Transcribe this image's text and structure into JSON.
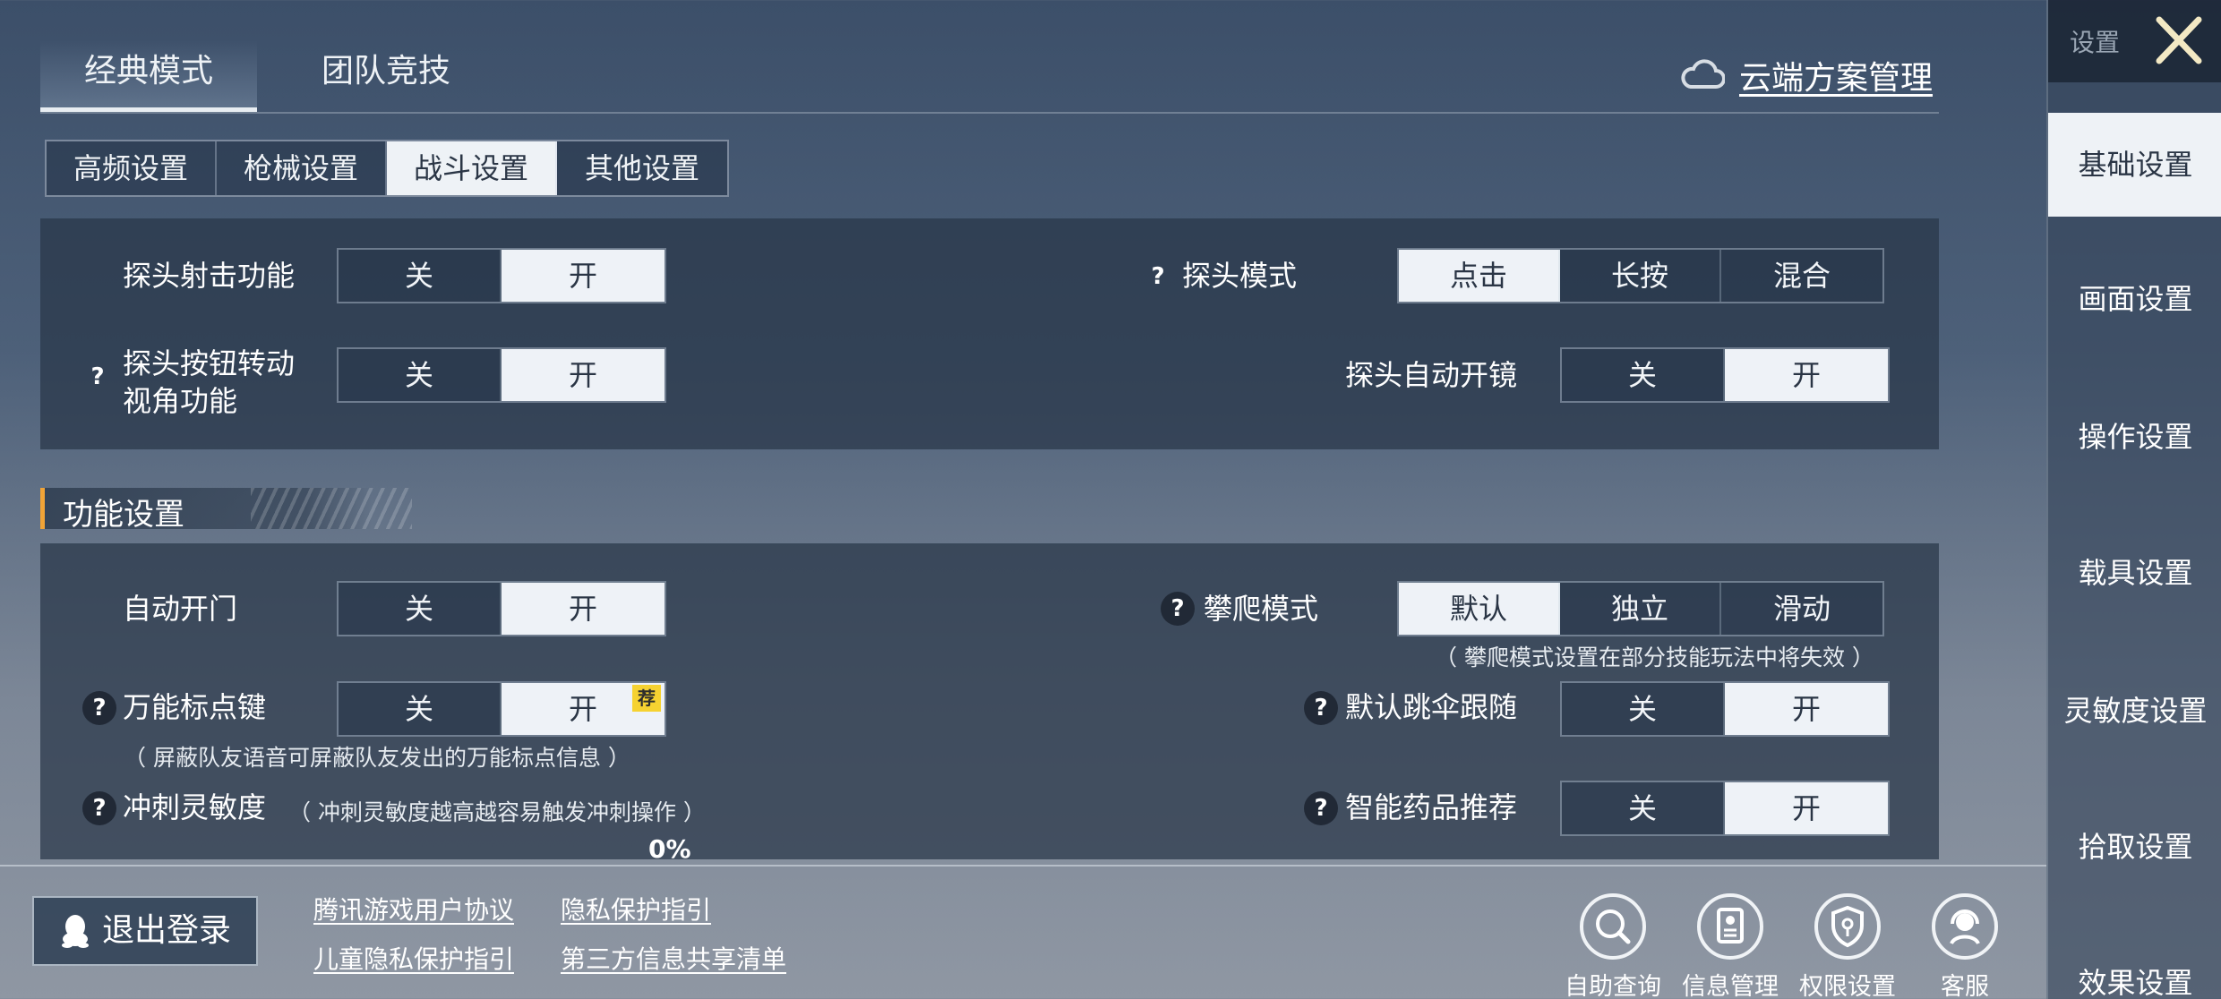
{
  "top_tabs": [
    "经典模式",
    "团队竞技"
  ],
  "cloud_link": "云端方案管理",
  "sub_tabs": [
    "高频设置",
    "枪械设置",
    "战斗设置",
    "其他设置"
  ],
  "peek": {
    "shoot_label": "探头射击功能",
    "shoot_options": [
      "关",
      "开"
    ],
    "mode_label": "探头模式",
    "mode_options": [
      "点击",
      "长按",
      "混合"
    ],
    "rotate_label_1": "探头按钮转动",
    "rotate_label_2": "视角功能",
    "rotate_options": [
      "关",
      "开"
    ],
    "scope_label": "探头自动开镜",
    "scope_options": [
      "关",
      "开"
    ]
  },
  "section_title": "功能设置",
  "features": {
    "door_label": "自动开门",
    "door_options": [
      "关",
      "开"
    ],
    "climb_label": "攀爬模式",
    "climb_options": [
      "默认",
      "独立",
      "滑动"
    ],
    "climb_note": "（ 攀爬模式设置在部分技能玩法中将失效 ）",
    "marker_label": "万能标点键",
    "marker_options": [
      "关",
      "开"
    ],
    "marker_badge": "荐",
    "marker_note": "（ 屏蔽队友语音可屏蔽队友发出的万能标点信息 ）",
    "parachute_label": "默认跳伞跟随",
    "parachute_options": [
      "关",
      "开"
    ],
    "sprint_label": "冲刺灵敏度",
    "sprint_note": "（ 冲刺灵敏度越高越容易触发冲刺操作 ）",
    "sprint_value": "0%",
    "medicine_label": "智能药品推荐",
    "medicine_options": [
      "关",
      "开"
    ]
  },
  "help_mark": "?",
  "bottom": {
    "logout": "退出登录",
    "links": [
      "腾讯游戏用户协议",
      "隐私保护指引",
      "儿童隐私保护指引",
      "第三方信息共享清单"
    ],
    "tools": [
      "自助查询",
      "信息管理",
      "权限设置",
      "客服"
    ]
  },
  "sidebar": {
    "title": "设置",
    "items": [
      "基础设置",
      "画面设置",
      "操作设置",
      "载具设置",
      "灵敏度设置",
      "拾取设置",
      "效果设置"
    ]
  }
}
